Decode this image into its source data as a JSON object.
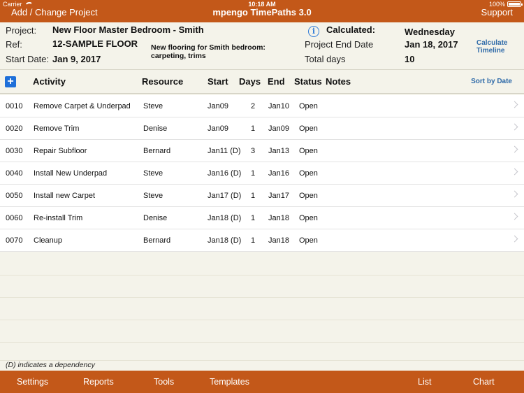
{
  "status_bar": {
    "carrier": "Carrier",
    "time": "10:18 AM",
    "battery": "100%"
  },
  "nav": {
    "left": "Add / Change Project",
    "title": "mpengo TimePaths 3.0",
    "right": "Support"
  },
  "project": {
    "project_label": "Project:",
    "project_value": "New Floor Master Bedroom - Smith",
    "ref_label": "Ref:",
    "ref_value": "12-SAMPLE FLOOR",
    "start_label": "Start Date:",
    "start_value": "Jan 9, 2017",
    "description": "New flooring for Smith bedroom: carpeting, trims",
    "calculated_label": "Calculated:",
    "calculated_value": "Wednesday",
    "end_label": "Project End Date",
    "end_value": "Jan 18, 2017",
    "total_label": "Total days",
    "total_value": "10",
    "calc_link": "Calculate Timeline"
  },
  "columns": {
    "activity": "Activity",
    "resource": "Resource",
    "start": "Start",
    "days": "Days",
    "end": "End",
    "status": "Status",
    "notes": "Notes",
    "sort": "Sort by Date"
  },
  "rows": [
    {
      "id": "0010",
      "activity": "Remove Carpet & Underpad",
      "resource": "Steve",
      "start": "Jan09",
      "days": "2",
      "end": "Jan10",
      "status": "Open"
    },
    {
      "id": "0020",
      "activity": "Remove Trim",
      "resource": "Denise",
      "start": "Jan09",
      "days": "1",
      "end": "Jan09",
      "status": "Open"
    },
    {
      "id": "0030",
      "activity": "Repair Subfloor",
      "resource": "Bernard",
      "start": "Jan11 (D)",
      "days": "3",
      "end": "Jan13",
      "status": "Open"
    },
    {
      "id": "0040",
      "activity": "Install New Underpad",
      "resource": "Steve",
      "start": "Jan16 (D)",
      "days": "1",
      "end": "Jan16",
      "status": "Open"
    },
    {
      "id": "0050",
      "activity": "Install new Carpet",
      "resource": "Steve",
      "start": "Jan17 (D)",
      "days": "1",
      "end": "Jan17",
      "status": "Open"
    },
    {
      "id": "0060",
      "activity": "Re-install Trim",
      "resource": "Denise",
      "start": "Jan18 (D)",
      "days": "1",
      "end": "Jan18",
      "status": "Open"
    },
    {
      "id": "0070",
      "activity": "Cleanup",
      "resource": "Bernard",
      "start": "Jan18 (D)",
      "days": "1",
      "end": "Jan18",
      "status": "Open"
    }
  ],
  "footnote": "(D) indicates a dependency",
  "tabs": {
    "settings": "Settings",
    "reports": "Reports",
    "tools": "Tools",
    "templates": "Templates",
    "list": "List",
    "chart": "Chart"
  },
  "colors": {
    "accent": "#c35819",
    "background": "#f4f3ea",
    "link": "#2e6aa8",
    "add_button": "#1e6fd9"
  },
  "icons": {
    "info": "info-icon",
    "add": "add-icon",
    "row_disclosure": "chevron-right-icon",
    "wifi": "wifi-icon",
    "battery": "battery-icon"
  }
}
